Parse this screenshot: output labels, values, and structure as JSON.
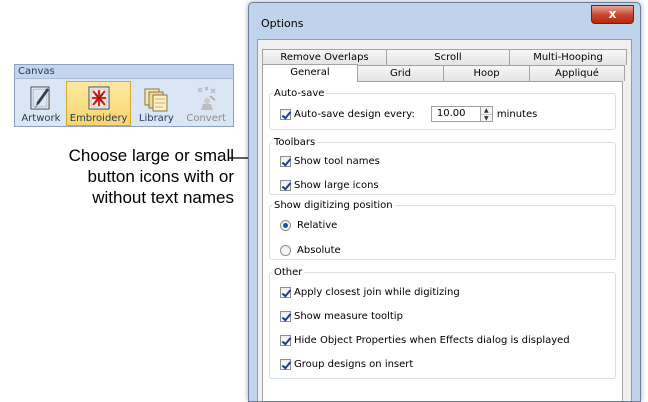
{
  "canvas": {
    "title": "Canvas",
    "buttons": [
      {
        "label": "Artwork",
        "icon": "artwork-icon",
        "state": "normal"
      },
      {
        "label": "Embroidery",
        "icon": "embroidery-icon",
        "state": "active"
      },
      {
        "label": "Library",
        "icon": "library-icon",
        "state": "normal"
      },
      {
        "label": "Convert",
        "icon": "convert-icon",
        "state": "disabled"
      }
    ]
  },
  "callout": {
    "lines": [
      "Choose large or small",
      "button icons with or",
      "without text names"
    ]
  },
  "dialog": {
    "title": "Options",
    "close_glyph": "x",
    "tabs_back": [
      "Remove Overlaps",
      "Scroll",
      "Multi-Hooping"
    ],
    "tabs_front": [
      "General",
      "Grid",
      "Hoop",
      "Appliqué"
    ],
    "selected_tab": "General",
    "autosave": {
      "legend": "Auto-save",
      "checkbox_label": "Auto-save design every:",
      "checked": true,
      "value": "10.00",
      "unit": "minutes"
    },
    "toolbars": {
      "legend": "Toolbars",
      "items": [
        {
          "label": "Show tool names",
          "checked": true
        },
        {
          "label": "Show large icons",
          "checked": true
        }
      ]
    },
    "digitizing": {
      "legend": "Show digitizing position",
      "options": [
        {
          "label": "Relative",
          "selected": true
        },
        {
          "label": "Absolute",
          "selected": false
        }
      ]
    },
    "other": {
      "legend": "Other",
      "items": [
        {
          "label": "Apply closest join while digitizing",
          "checked": true
        },
        {
          "label": "Show measure tooltip",
          "checked": true
        },
        {
          "label": "Hide Object Properties when Effects dialog is displayed",
          "checked": true
        },
        {
          "label": "Group designs on insert",
          "checked": true
        }
      ]
    }
  },
  "colors": {
    "dialog_frame": "#bfd3ea",
    "close_button": "#c7442b",
    "active_button": "#fbd56c",
    "toolbar_bg": "#dbe6f4"
  }
}
